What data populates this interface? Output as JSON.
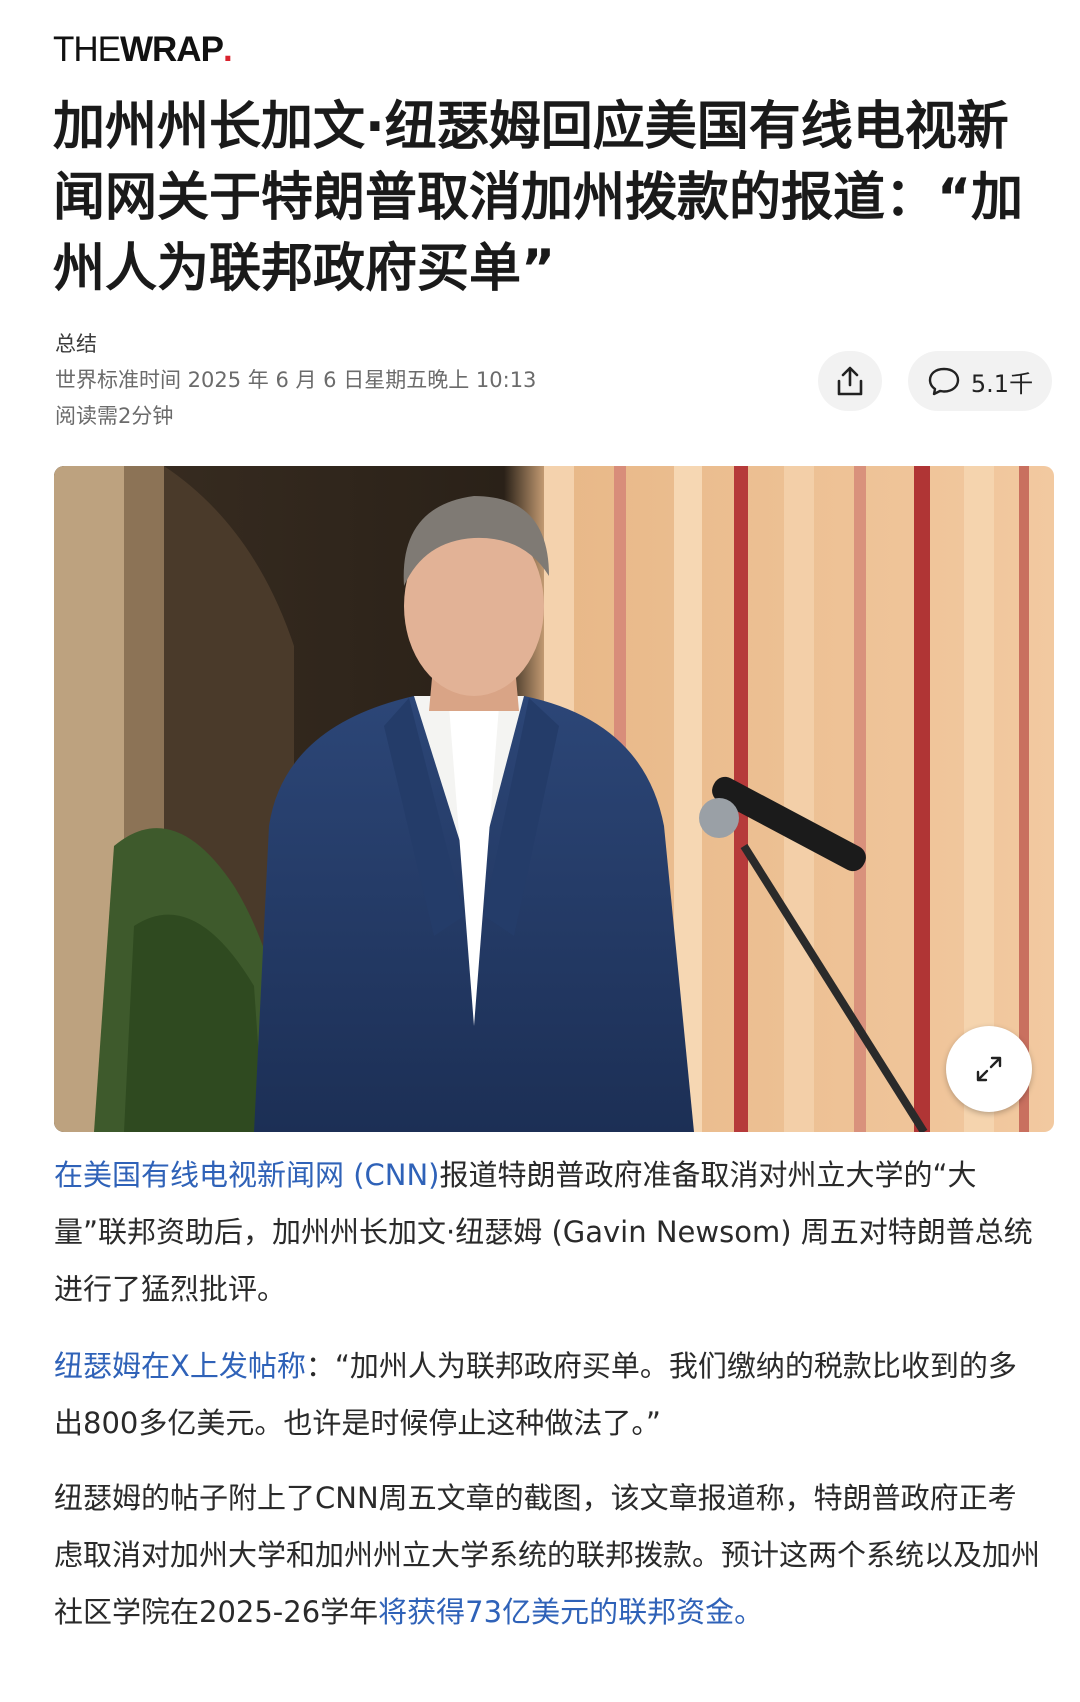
{
  "brand": {
    "logo_thin": "THE",
    "logo_bold": "WRAP",
    "logo_dot": ".",
    "accent_color": "#d9232e"
  },
  "article": {
    "headline": "加州州长加文·纽瑟姆回应美国有线电视新闻网关于特朗普取消加州拨款的报道：“加州人为联邦政府买单”",
    "summary_label": "总结",
    "timestamp": "世界标准时间 2025 年 6 月 6 日星期五晚上 10:13",
    "read_time": "阅读需2分钟",
    "comment_count": "5.1千"
  },
  "image": {
    "description_icon": "expand-icon"
  },
  "body": {
    "p1_link": "在美国有线电视新闻网 (CNN)",
    "p1_text": "报道特朗普政府准备取消对州立大学的“大量”联邦资助后，加州州长加文·纽瑟姆 (Gavin Newsom) 周五对特朗普总统进行了猛烈批评。",
    "p2_link": "纽瑟姆在X上发帖称",
    "p2_text": "：“加州人为联邦政府买单。我们缴纳的税款比收到的多出800多亿美元。也许是时候停止这种做法了。”",
    "p3_text": "纽瑟姆的帖子附上了CNN周五文章的截图，该文章报道称，特朗普政府正考虑取消对加州大学和加州州立大学系统的联邦拨款。预计这两个系统以及加州社区学院在2025-26学年",
    "p3_link": "将获得73亿美元的联邦资金。"
  },
  "colors": {
    "link": "#2f62b8",
    "button_bg": "#f2f2f2"
  }
}
